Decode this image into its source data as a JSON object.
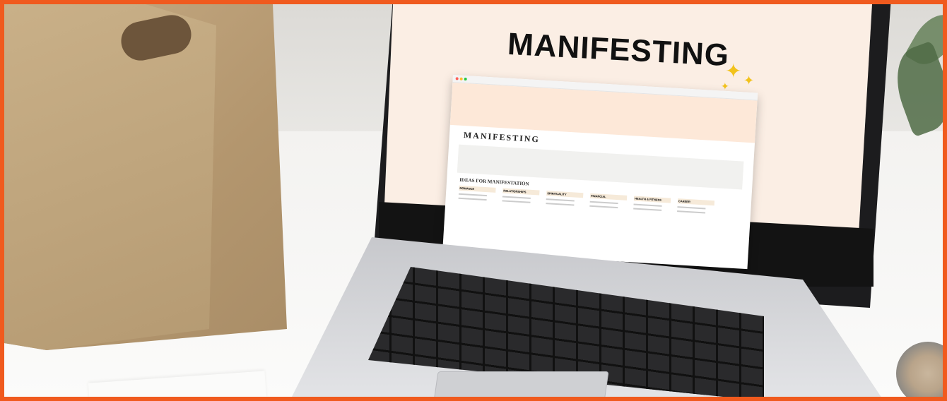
{
  "screen": {
    "heading": "MANIFESTING",
    "page_title": "MANIFESTING",
    "section_heading": "IDEAS FOR MANIFESTATION",
    "categories": [
      "ROMANCE",
      "RELATIONSHIPS",
      "SPIRITUALITY",
      "FINANCIAL",
      "HEALTH & FITNESS",
      "CAREER"
    ]
  },
  "colors": {
    "border": "#f05a1e",
    "sparkle": "#f2c21b",
    "screen_bg": "#fbeee4"
  }
}
